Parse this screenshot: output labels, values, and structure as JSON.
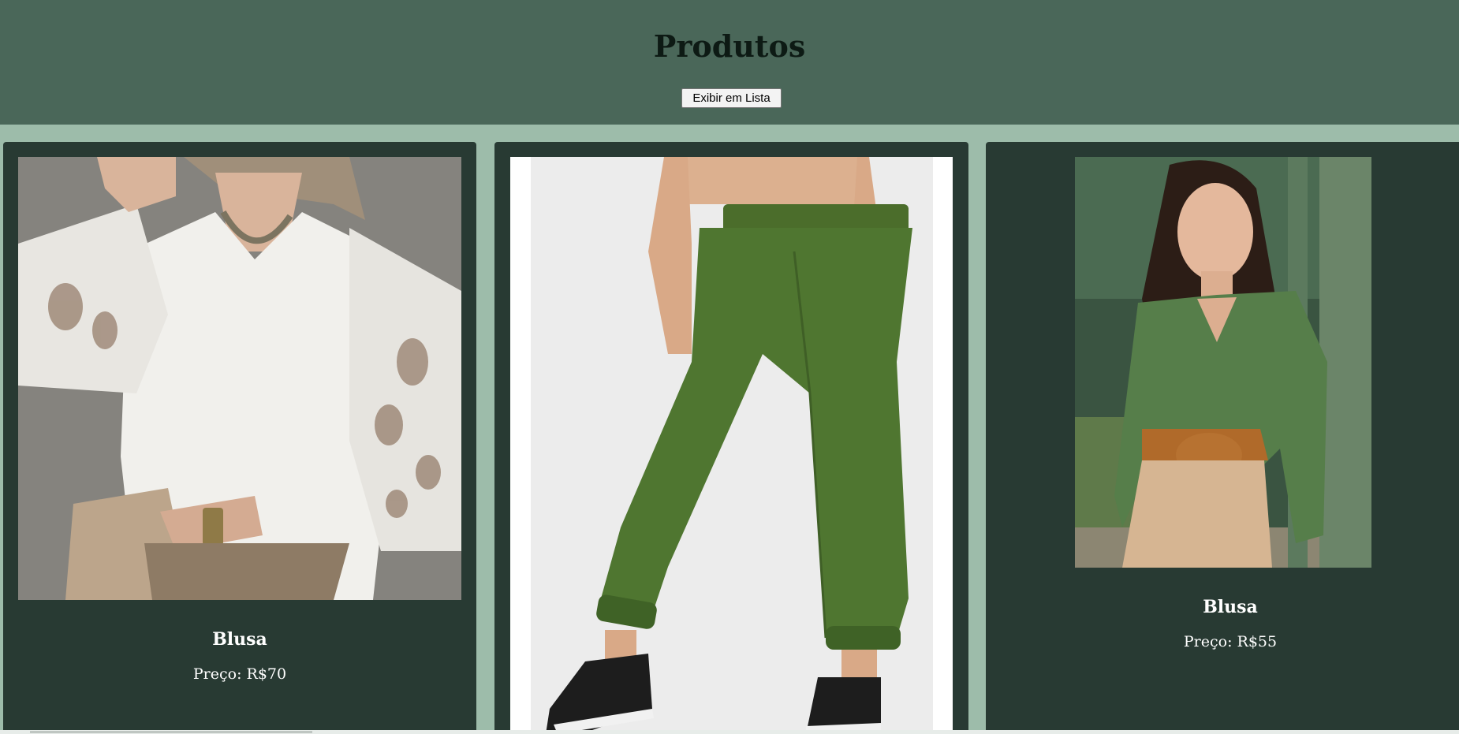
{
  "header": {
    "title": "Produtos",
    "toggle_label": "Exibir em Lista"
  },
  "products": [
    {
      "name": "Blusa",
      "price": "Preço: R$70",
      "image_icon": "white-lace-blouse-photo"
    },
    {
      "name": "",
      "price": "",
      "image_icon": "green-jogger-pants-photo"
    },
    {
      "name": "Blusa",
      "price": "Preço: R$55",
      "image_icon": "green-blouse-belt-photo"
    }
  ],
  "colors": {
    "page_background": "#9dbcaa",
    "header_background": "#4a6759",
    "card_background": "#283a33",
    "text_on_card": "#ffffff"
  }
}
